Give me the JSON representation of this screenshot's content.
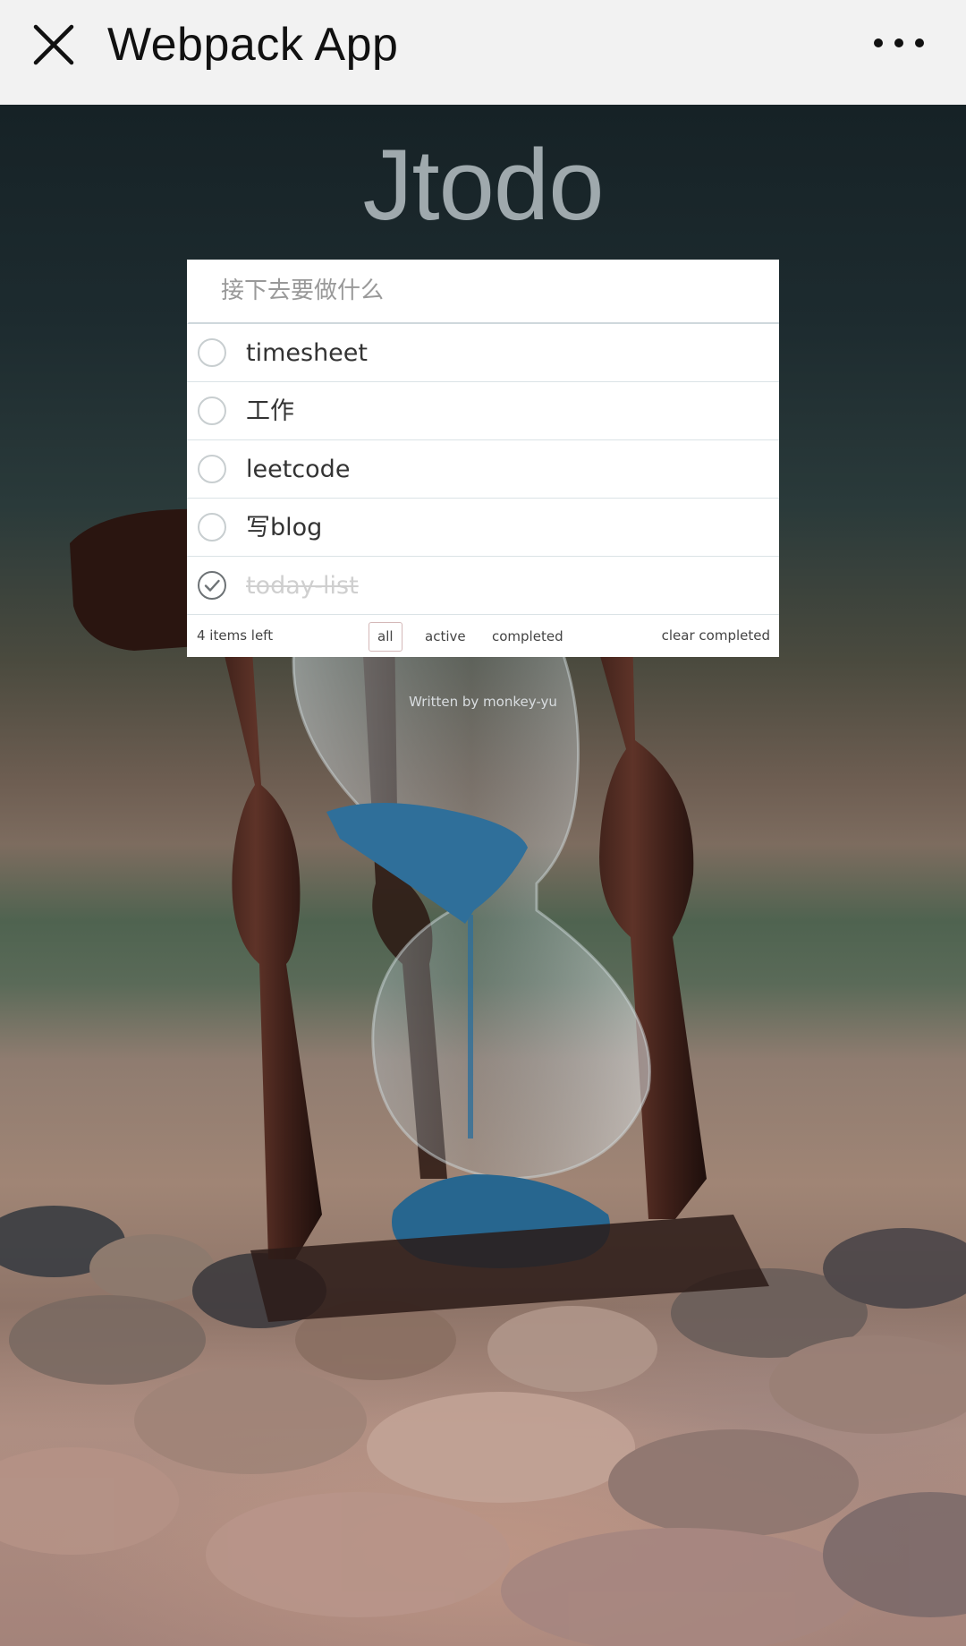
{
  "window": {
    "title": "Webpack App",
    "close_icon": "close-icon",
    "more_icon": "more-horizontal-icon"
  },
  "app": {
    "brand": "Jtodo",
    "new_todo_placeholder": "接下去要做什么",
    "todos": [
      {
        "label": "timesheet",
        "completed": false
      },
      {
        "label": "工作",
        "completed": false
      },
      {
        "label": "leetcode",
        "completed": false
      },
      {
        "label": "写blog",
        "completed": false
      },
      {
        "label": "today-list",
        "completed": true
      }
    ],
    "footer": {
      "items_left": "4 items left",
      "filters": [
        "all",
        "active",
        "completed"
      ],
      "selected_filter": "all",
      "clear_completed": "clear completed"
    },
    "credit": "Written by monkey-yu"
  },
  "colors": {
    "topbar_bg": "#f2f2f2",
    "brand_text": "#9fa9ad",
    "sand": "#2f6f9a"
  }
}
